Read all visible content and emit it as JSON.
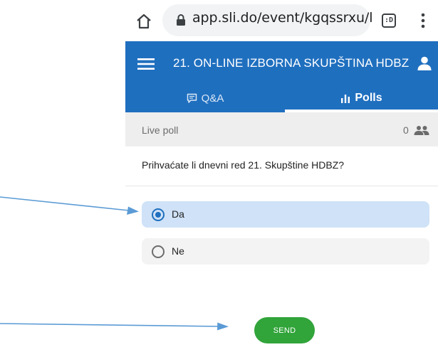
{
  "browser": {
    "url": "app.sli.do/event/kgqssrxu/l",
    "tab_count": ":D",
    "icons": [
      "home-icon",
      "lock-icon",
      "tabs-icon",
      "kebab-menu-icon"
    ]
  },
  "header": {
    "title": "21. ON-LINE IZBORNA SKUPŠTINA HDBZ",
    "background_color": "#1f6fbf",
    "tabs": [
      {
        "label": "Q&A",
        "icon": "speech-bubble-icon",
        "active": false
      },
      {
        "label": "Polls",
        "icon": "bar-chart-icon",
        "active": true
      }
    ]
  },
  "poll": {
    "status_label": "Live poll",
    "participant_count": "0",
    "question": "Prihvaćate li dnevni red 21. Skupštine HDBZ?",
    "options": [
      {
        "label": "Da",
        "selected": true
      },
      {
        "label": "Ne",
        "selected": false
      }
    ],
    "selected_color": "#cfe2f7",
    "submit_label": "SEND",
    "submit_color": "#31a43a"
  },
  "annotations": {
    "arrows": [
      "arrow-to-option-da",
      "arrow-to-send-button"
    ],
    "arrow_color": "#5b9bd5"
  }
}
